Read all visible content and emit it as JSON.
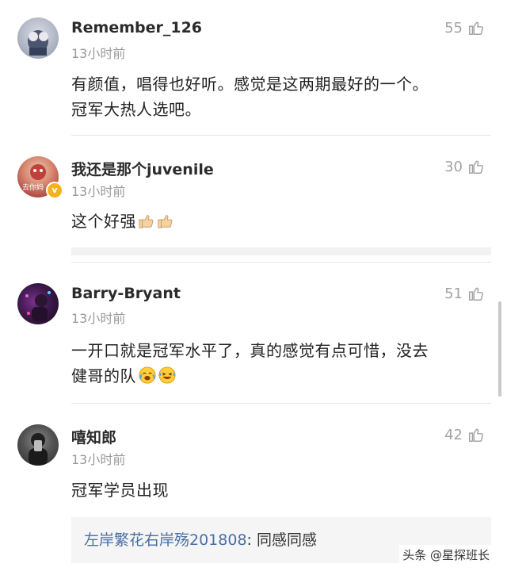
{
  "comments": [
    {
      "username": "Remember_126",
      "time": "13小时前",
      "likes": "55",
      "text_lines": [
        "有颜值，唱得也好听。感觉是这两期最好的一个。",
        "冠军大热人选吧。"
      ]
    },
    {
      "username": "我还是那个juvenile",
      "time": "13小时前",
      "likes": "30",
      "text": "这个好强",
      "avatar_text": "去你妈",
      "emojis": [
        "thumbs-up-icon",
        "thumbs-up-icon"
      ]
    },
    {
      "username": "Barry-Bryant",
      "time": "13小时前",
      "likes": "51",
      "text_lines": [
        "一开口就是冠军水平了，真的感觉有点可惜，没去",
        "健哥的队"
      ],
      "emojis": [
        "crying-face-icon",
        "laughing-face-icon"
      ]
    },
    {
      "username": "嘻知郎",
      "time": "13小时前",
      "likes": "42",
      "text": "冠军学员出现",
      "reply": {
        "user": "左岸繁花右岸殇201808",
        "sep": ": ",
        "text": "同感同感"
      }
    }
  ],
  "watermark": "头条 @星探班长",
  "colors": {
    "username": "#2b2b2b",
    "time": "#9a9a9a",
    "reply_user": "#4a6fa5",
    "likes": "#a3a3a3"
  }
}
